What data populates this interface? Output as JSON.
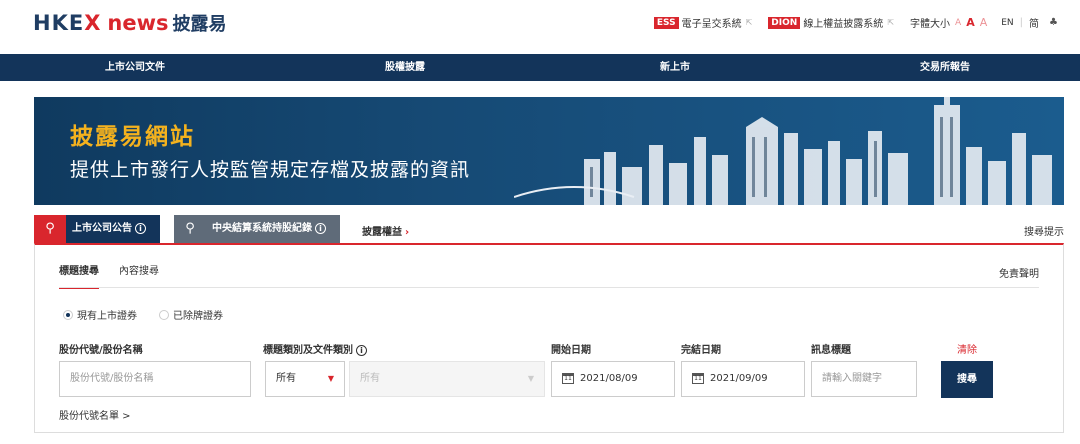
{
  "header": {
    "logo_hkex": "HKE",
    "logo_x": "X",
    "logo_news": "news",
    "logo_cn": "披露易",
    "ess_tag": "ESS",
    "ess_label": "電子呈交系統",
    "dion_tag": "DION",
    "dion_label": "線上權益披露系統",
    "font_size_label": "字體大小",
    "font_a": "A",
    "lang_en": "EN",
    "lang_sc": "简"
  },
  "nav": {
    "items": [
      "上市公司文件",
      "股權披露",
      "新上市",
      "交易所報告"
    ]
  },
  "banner": {
    "title": "披露易網站",
    "subtitle": "提供上市發行人按監管規定存檔及披露的資訊"
  },
  "search": {
    "tab_announcements": "上市公司公告",
    "tab_ccass": "中央結算系統持股紀錄",
    "equity_link": "披露權益",
    "equity_chev": "›",
    "search_tips": "搜尋提示",
    "subtabs": [
      "標題搜尋",
      "內容搜尋"
    ],
    "disclaimer": "免責聲明",
    "radio_current": "現有上市證券",
    "radio_delisted": "已除牌證券",
    "label_stock": "股份代號/股份名稱",
    "label_category": "標題類別及文件類別",
    "label_start": "開始日期",
    "label_end": "完結日期",
    "label_headline": "訊息標題",
    "clear": "清除",
    "stock_placeholder": "股份代號/股份名稱",
    "category_value": "所有",
    "doc_type_value": "所有",
    "start_date": "2021/08/09",
    "end_date": "2021/09/09",
    "headline_placeholder": "請輸入關鍵字",
    "search_button": "搜尋",
    "stock_list_link": "股份代號名單 >"
  },
  "colors": {
    "brand_red": "#d9262d",
    "navy": "#13345a",
    "gold": "#f4b21e"
  }
}
